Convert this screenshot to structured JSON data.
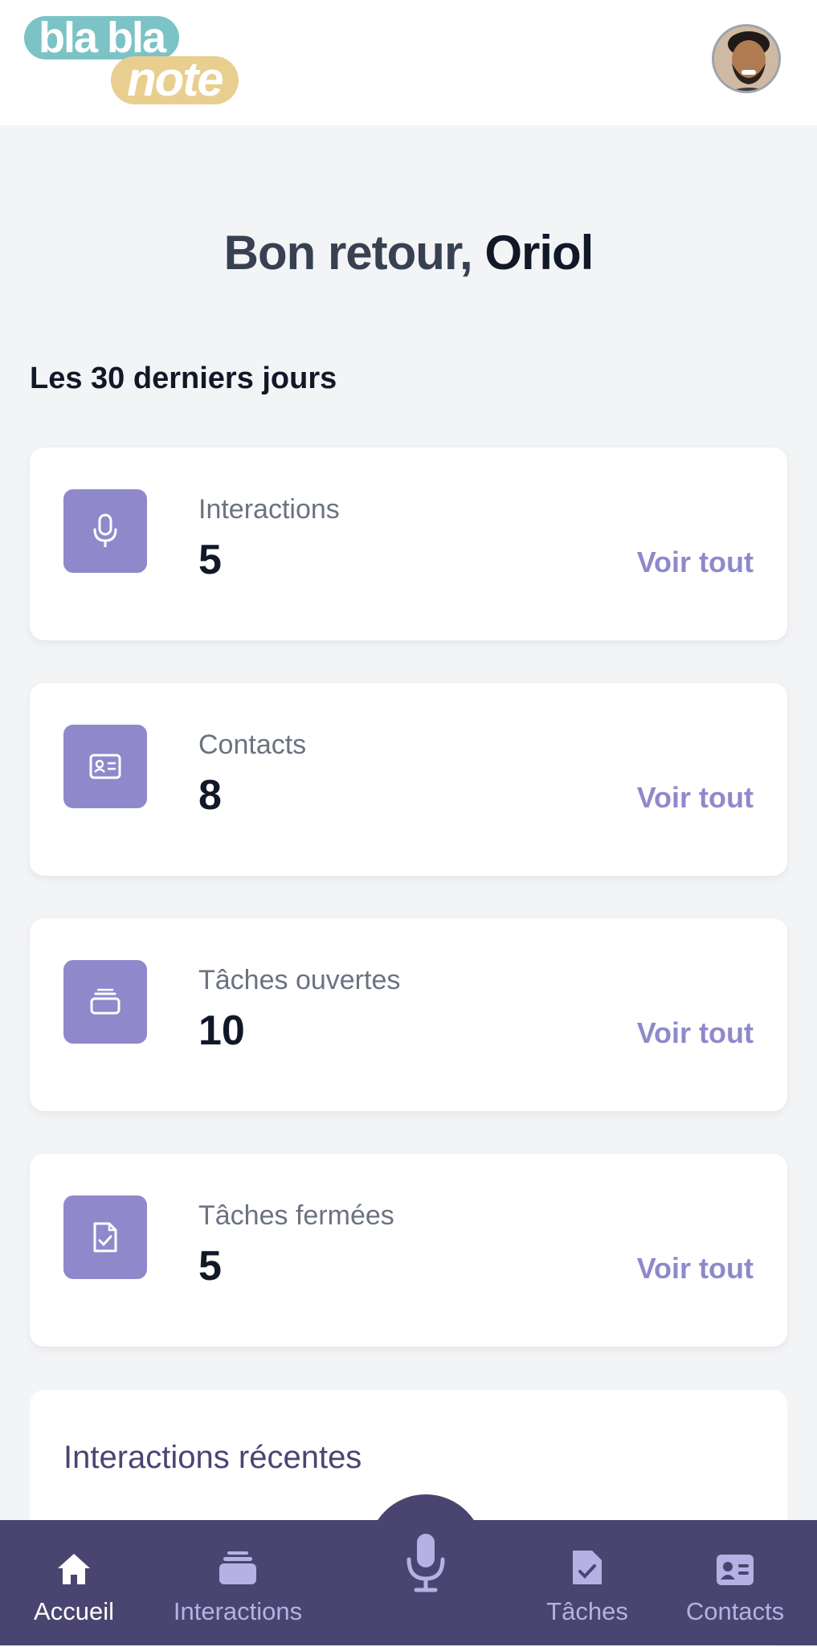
{
  "logo": {
    "line1": "bla bla",
    "line2": "note"
  },
  "greeting": {
    "prefix": "Bon retour,",
    "name": "Oriol"
  },
  "section_title": "Les 30 derniers jours",
  "stats": [
    {
      "label": "Interactions",
      "value": "5",
      "link": "Voir tout",
      "icon": "microphone-icon"
    },
    {
      "label": "Contacts",
      "value": "8",
      "link": "Voir tout",
      "icon": "contact-card-icon"
    },
    {
      "label": "Tâches ouvertes",
      "value": "10",
      "link": "Voir tout",
      "icon": "inbox-stack-icon"
    },
    {
      "label": "Tâches fermées",
      "value": "5",
      "link": "Voir tout",
      "icon": "document-check-icon"
    }
  ],
  "recent": {
    "title": "Interactions récentes"
  },
  "nav": [
    {
      "label": "Accueil",
      "icon": "home-icon",
      "active": true
    },
    {
      "label": "Interactions",
      "icon": "stack-icon",
      "active": false
    },
    {
      "label": "",
      "icon": "microphone-icon",
      "active": false
    },
    {
      "label": "Tâches",
      "icon": "document-check-icon",
      "active": false
    },
    {
      "label": "Contacts",
      "icon": "contact-card-icon",
      "active": false
    }
  ],
  "colors": {
    "accent": "#8f89cb",
    "nav_bg": "#4a4570",
    "nav_text": "#b5b1e4",
    "logo_teal": "#7cc3c5",
    "logo_gold": "#e9cf8f"
  }
}
